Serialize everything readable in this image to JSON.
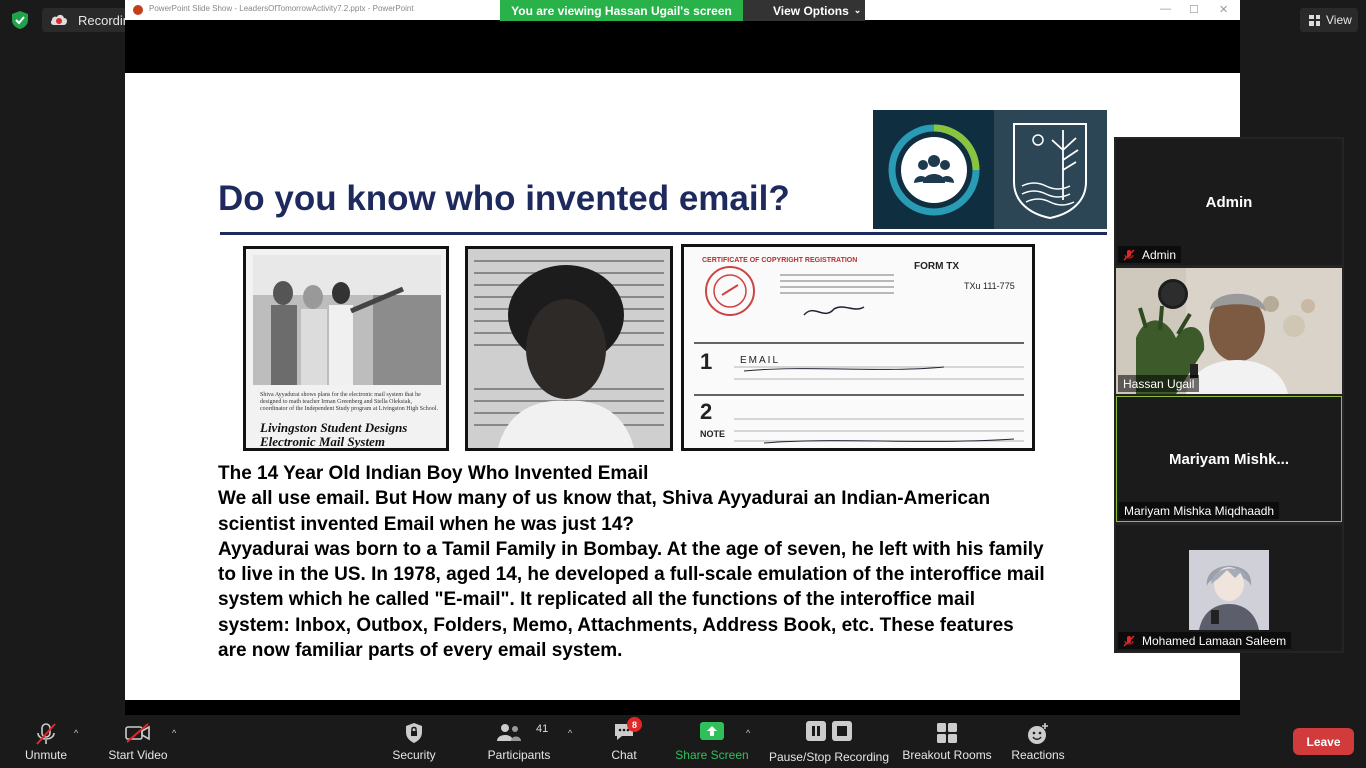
{
  "meeting": {
    "recording_label": "Recording...",
    "banner_text": "You are viewing Hassan Ugail's screen",
    "view_options_label": "View Options",
    "view_label": "View",
    "shared_window_title": "PowerPoint Slide Show - LeadersOfTomorrowActivity7.2.pptx - PowerPoint"
  },
  "slide": {
    "title": "Do you know who invented email?",
    "photo1_caption_big": "Livingston Student Designs\nElectronic Mail System",
    "photo1_caption_small": "Shiva Ayyadurai shows plans for the electronic mail system that he designed to math teacher Irman Greenberg and Stella Oleksiak, coordinator of the Independent Study program at Livingston High School.",
    "cert_title": "CERTIFICATE OF COPYRIGHT REGISTRATION",
    "cert_form": "FORM TX",
    "cert_number": "TXu    111-775",
    "cert_work_title": "EMAIL",
    "cert_section1": "1",
    "cert_section2": "2",
    "cert_note": "NOTE",
    "body_lines": [
      "The 14 Year Old Indian Boy Who Invented Email",
      "We all use email. But How many of us know that, Shiva Ayyadurai an Indian-American",
      "scientist invented Email when he was just 14?",
      "Ayyadurai was born to a Tamil Family in Bombay. At the age of seven, he left with his family",
      "to live in the US. In 1978, aged 14, he developed a full-scale emulation of the interoffice mail",
      "system which he called \"E-mail\". It replicated all the functions of the interoffice mail",
      "system: Inbox, Outbox, Folders, Memo, Attachments, Address Book, etc. These features",
      "are now familiar parts of every email system."
    ]
  },
  "participants_panel": {
    "tiles": [
      {
        "center_name": "Admin",
        "label": "Admin",
        "muted": true
      },
      {
        "center_name": "",
        "label": "Hassan Ugail",
        "muted": false,
        "video": true
      },
      {
        "center_name": "Mariyam  Mishk...",
        "label": "Mariyam Mishka Miqdhaadh",
        "muted": false,
        "active": true
      },
      {
        "center_name": "",
        "label": "Mohamed Lamaan Saleem",
        "muted": true,
        "avatar": true
      }
    ]
  },
  "toolbar": {
    "unmute": "Unmute",
    "start_video": "Start Video",
    "security": "Security",
    "participants": "Participants",
    "participants_count": "41",
    "chat": "Chat",
    "chat_badge": "8",
    "share_screen": "Share Screen",
    "pause_stop_recording": "Pause/Stop Recording",
    "breakout_rooms": "Breakout Rooms",
    "reactions": "Reactions",
    "leave": "Leave"
  },
  "colors": {
    "banner_green": "#2ab24a",
    "share_green": "#2fc05a",
    "leave_red": "#d13b3b",
    "slide_title_navy": "#1e2a5e",
    "active_speaker_border": "#8fbf3a"
  }
}
